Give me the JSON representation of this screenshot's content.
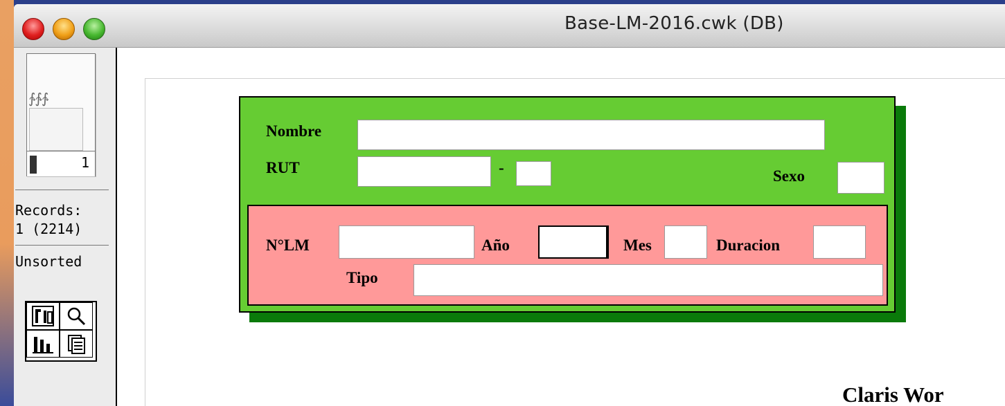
{
  "window": {
    "title": "Base-LM-2016.cwk (DB)"
  },
  "sidebar": {
    "record_number": "1",
    "records_label": "Records:",
    "records_value": "1 (2214)",
    "sort_status": "Unsorted",
    "tools": [
      "layout-icon",
      "find-icon",
      "list-icon",
      "browse-icon"
    ]
  },
  "form": {
    "nombre_label": "Nombre",
    "nombre_value": "",
    "rut_label": "RUT",
    "rut_value": "",
    "rut_dash": "-",
    "rut_dv_value": "",
    "sexo_label": "Sexo",
    "sexo_value": "",
    "nlm_label": "N°LM",
    "nlm_value": "",
    "ano_label": "Año",
    "ano_value": "",
    "mes_label": "Mes",
    "mes_value": "",
    "duracion_label": "Duracion",
    "duracion_value": "",
    "tipo_label": "Tipo",
    "tipo_value": ""
  },
  "overlay_text": "Claris Wor",
  "colors": {
    "outer_panel": "#66cc33",
    "outer_shadow": "#0a7a0a",
    "inner_panel": "#ff9999",
    "desktop": "#e99c5d"
  }
}
